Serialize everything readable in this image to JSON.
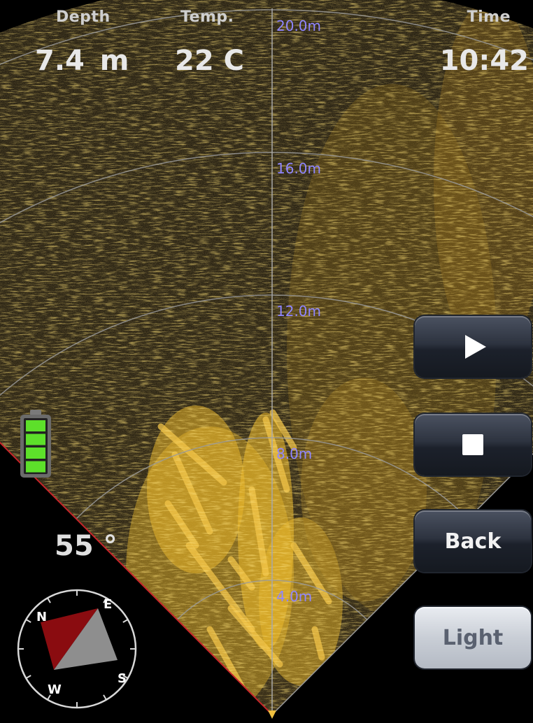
{
  "hud": {
    "depth_label": "Depth",
    "depth_value": "7.4  m",
    "temp_label": "Temp.",
    "temp_value": "22 C",
    "time_label": "Time",
    "time_value": "10:42"
  },
  "sonar": {
    "range_labels": [
      "20.0m",
      "16.0m",
      "12.0m",
      "8.0m",
      "4.0m"
    ],
    "label_color": "#8f86ff",
    "echo_color": "#e7b52a"
  },
  "controls": {
    "back_label": "Back",
    "light_label": "Light"
  },
  "battery": {
    "level_bars": 4,
    "total_bars": 4,
    "color": "#5de02a"
  },
  "heading": {
    "value": "55 °"
  },
  "compass": {
    "labels": [
      "N",
      "E",
      "S",
      "W"
    ],
    "north_color": "#8a0c10",
    "south_color": "#8e8e8e"
  }
}
